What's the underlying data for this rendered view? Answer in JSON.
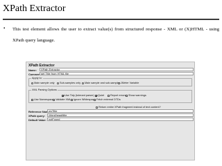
{
  "slide": {
    "title": "XPath Extractor",
    "bullet": "•",
    "text": "This test element allows the user to extract value(s) from structured response - XML or (X)HTML - using XPath query language."
  },
  "panel": {
    "heading": "XPath Extractor",
    "name_label": "Name:",
    "name_value": "XPath Extractor",
    "comments_label": "Comments:",
    "comments_value": "get Title from HTML file",
    "apply_to": {
      "title": "Apply to:",
      "options": [
        {
          "label": "Main sample only",
          "selected": true
        },
        {
          "label": "Sub-samples only",
          "selected": false
        },
        {
          "label": "Main sample and sub-samples",
          "selected": false
        },
        {
          "label": "JMeter Variable",
          "selected": false
        }
      ]
    },
    "parsing": {
      "title": "XML Parsing Options",
      "row1": [
        {
          "label": "Use Tidy (tolerant parser)",
          "checked": true
        },
        {
          "label": "Quiet",
          "checked": true
        },
        {
          "label": "Report errors",
          "checked": false
        },
        {
          "label": "Show warnings",
          "checked": false
        }
      ],
      "row2": [
        {
          "label": "Use Namespaces",
          "checked": false
        },
        {
          "label": "Validate XML",
          "checked": false
        },
        {
          "label": "Ignore Whitespace",
          "checked": false
        },
        {
          "label": "Fetch external DTDs",
          "checked": false
        }
      ],
      "fragment": {
        "label": "Return entire XPath fragment instead of text content?",
        "checked": false
      }
    },
    "reference_label": "Reference Name:",
    "reference_value": "myTitle",
    "xpath_label": "XPath query:",
    "xpath_value": "//html/head/title",
    "default_label": "Default Value:",
    "default_value": "notFound"
  }
}
